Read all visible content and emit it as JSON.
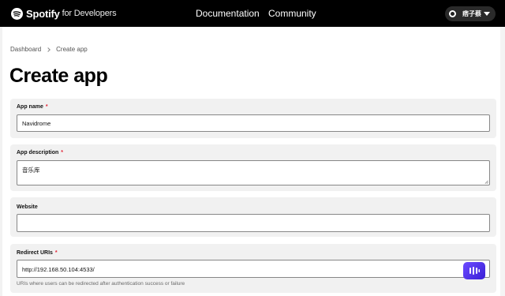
{
  "header": {
    "brand": "Spotify",
    "brand_suffix": "for Developers",
    "nav": {
      "documentation": "Documentation",
      "community": "Community"
    },
    "user": {
      "name": "痞子蔡"
    }
  },
  "breadcrumb": {
    "items": [
      "Dashboard",
      "Create app"
    ]
  },
  "page": {
    "title": "Create app"
  },
  "form": {
    "app_name": {
      "label": "App name",
      "required_mark": "*",
      "value": "Navidrome"
    },
    "app_description": {
      "label": "App description",
      "required_mark": "*",
      "value": "音乐库"
    },
    "website": {
      "label": "Website",
      "value": ""
    },
    "redirect_uris": {
      "label": "Redirect URIs",
      "required_mark": "*",
      "value": "http://192.168.50.104:4533/",
      "hint": "URIs where users can be redirected after authentication success or failure"
    }
  },
  "colors": {
    "topbar": "#000000",
    "required": "#e22134",
    "card": "#f1f1f1",
    "fab": "#5a35f0"
  },
  "icons": [
    "spotify-logo-icon",
    "avatar-icon",
    "chevron-down-icon",
    "breadcrumb-chevron-icon",
    "resize-grip-icon",
    "floating-assistant-icon"
  ]
}
